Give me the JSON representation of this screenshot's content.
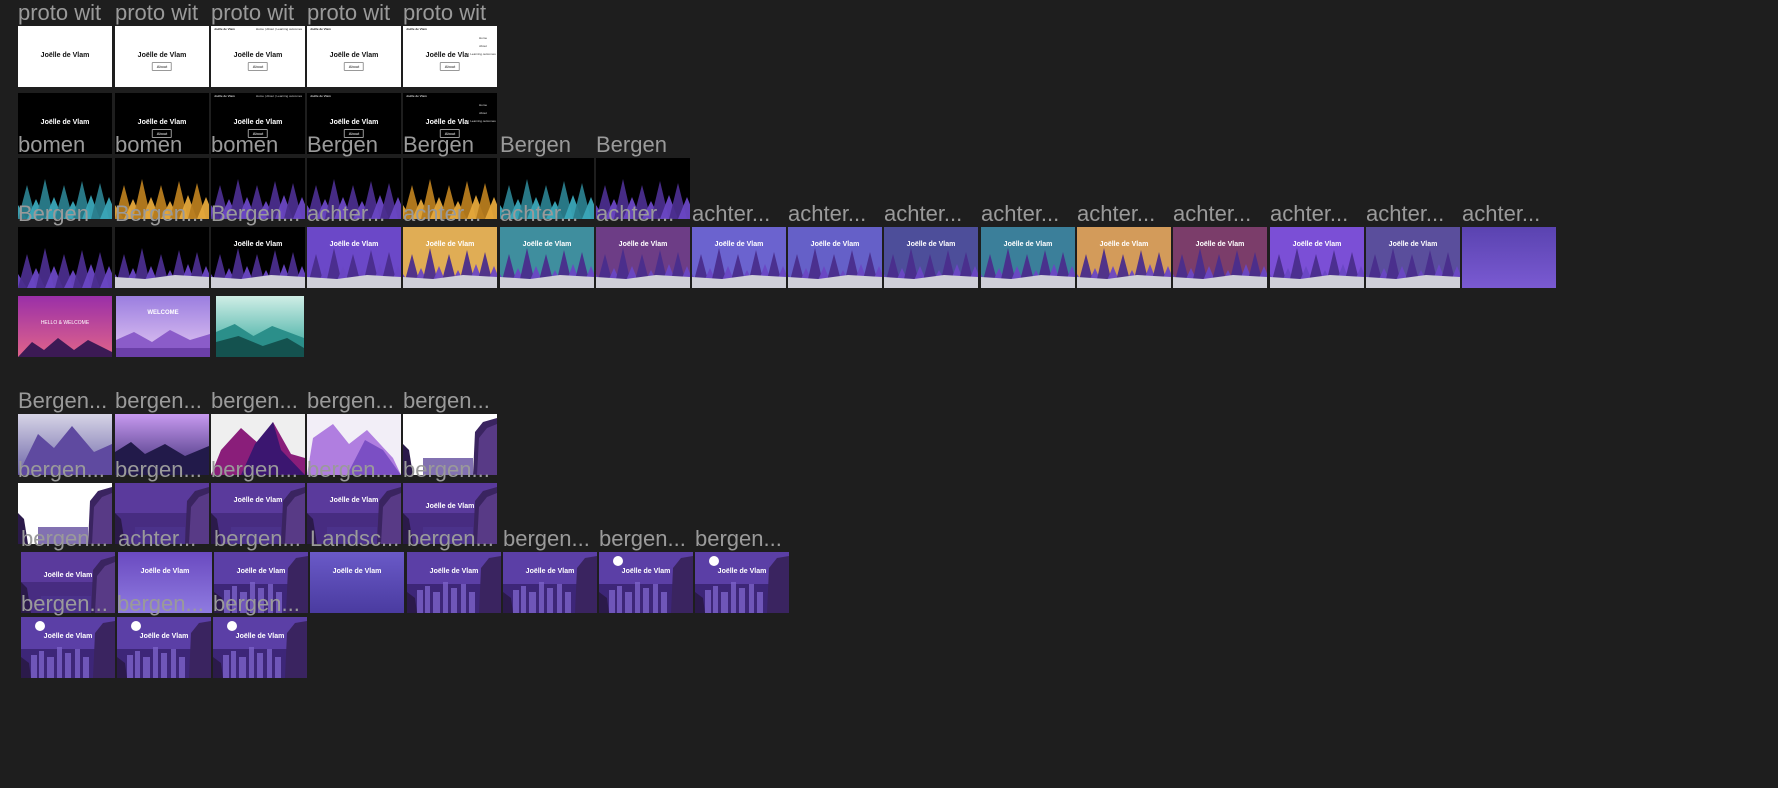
{
  "brand": "Joëlle de Vlam",
  "about_label": "About",
  "nav_text": "Home | About | Learning outcomes",
  "menu_items": [
    "Home",
    "About",
    "Learning outcomes"
  ],
  "hero": {
    "title": "HELLO & WELCOME",
    "welcome": "WELCOME"
  },
  "labels": {
    "proto_wit": "proto wit",
    "bomen": "bomen",
    "bergen_cap": "Bergen",
    "bergen_trunc": "Bergen...",
    "achter": "achter...",
    "bergen_lower": "bergen...",
    "landsc": "Landsc..."
  },
  "colors": {
    "canvas": "#1e1e1e",
    "purple": "#6b48c8",
    "orange": "#e5a83b",
    "teal": "#3aa7b8",
    "deep_purple": "#4a2d8c"
  }
}
